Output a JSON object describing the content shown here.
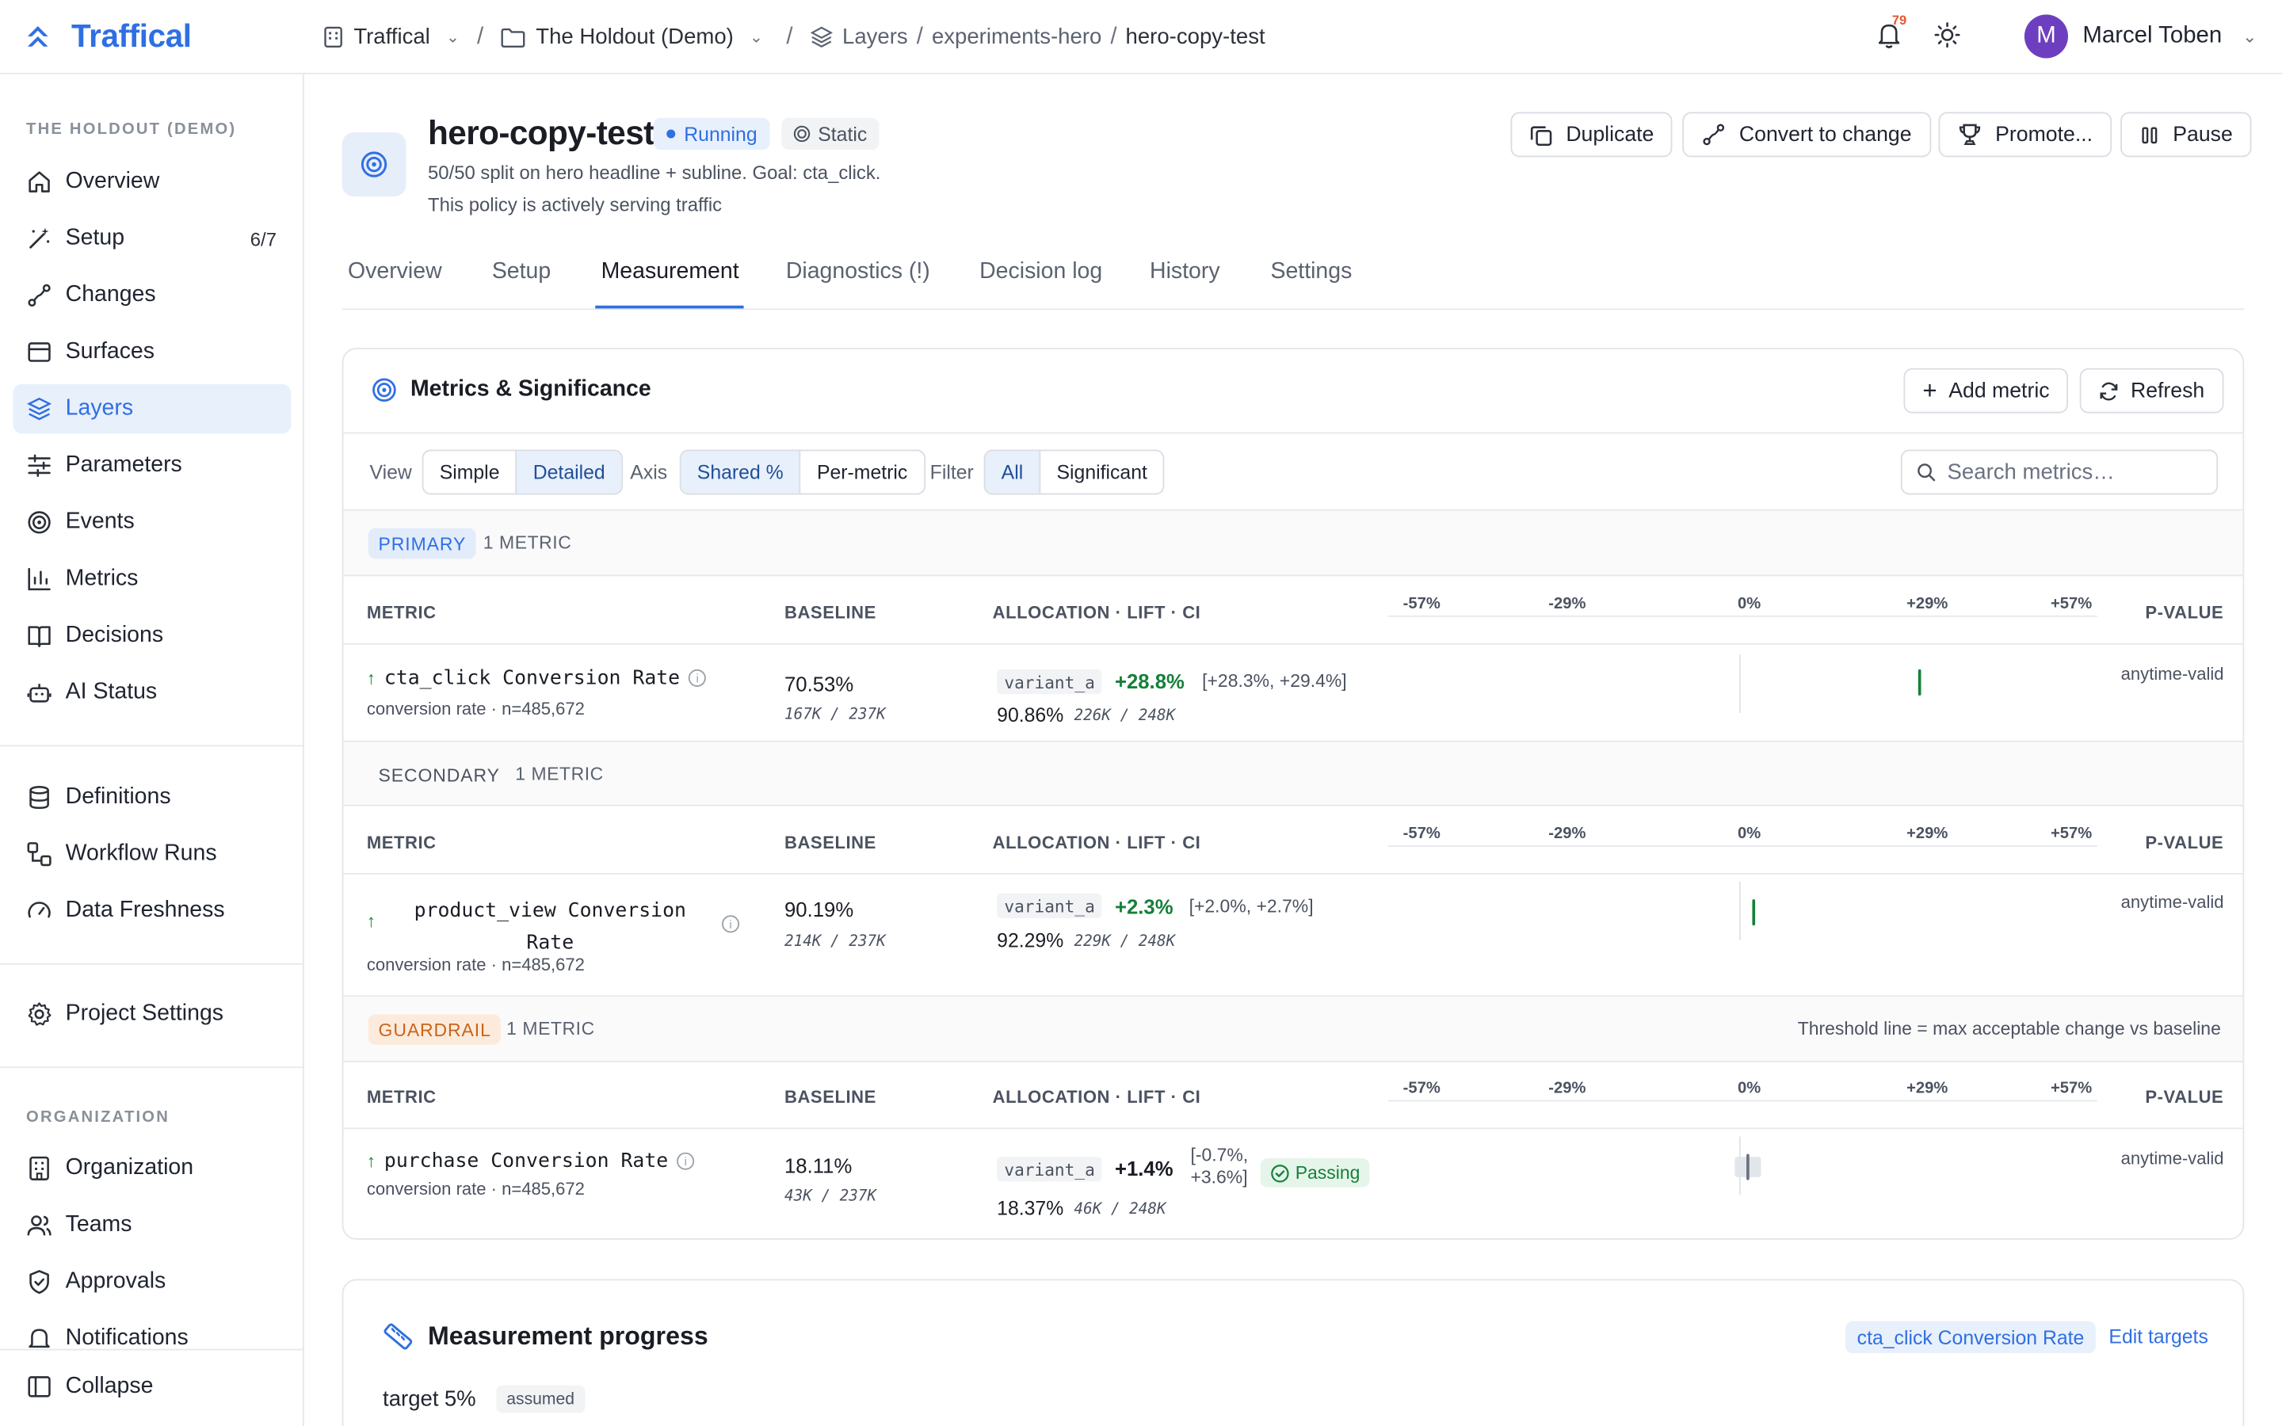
{
  "brand": {
    "name": "Traffical",
    "accent": "#2f6fe4"
  },
  "breadcrumbs": {
    "org": "Traffical",
    "project": "The Holdout (Demo)",
    "layers": "Layers",
    "layer": "experiments-hero",
    "current": "hero-copy-test"
  },
  "topbar": {
    "notification_count": "79",
    "user_name": "Marcel Toben",
    "user_initial": "M"
  },
  "sidebar": {
    "section_project": "THE HOLDOUT (DEMO)",
    "items": [
      {
        "label": "Overview",
        "icon": "home-icon"
      },
      {
        "label": "Setup",
        "icon": "wand-icon",
        "count": "6/7"
      },
      {
        "label": "Changes",
        "icon": "changes-icon"
      },
      {
        "label": "Surfaces",
        "icon": "window-icon"
      },
      {
        "label": "Layers",
        "icon": "layers-icon"
      },
      {
        "label": "Parameters",
        "icon": "sliders-icon"
      },
      {
        "label": "Events",
        "icon": "target-icon"
      },
      {
        "label": "Metrics",
        "icon": "bar-chart-icon"
      },
      {
        "label": "Decisions",
        "icon": "book-icon"
      },
      {
        "label": "AI Status",
        "icon": "bot-icon"
      }
    ],
    "items2": [
      {
        "label": "Definitions",
        "icon": "database-icon"
      },
      {
        "label": "Workflow Runs",
        "icon": "workflow-icon"
      },
      {
        "label": "Data Freshness",
        "icon": "gauge-icon"
      }
    ],
    "project_settings": "Project Settings",
    "section_org": "ORGANIZATION",
    "org_items": [
      {
        "label": "Organization",
        "icon": "building-icon"
      },
      {
        "label": "Teams",
        "icon": "users-icon"
      },
      {
        "label": "Approvals",
        "icon": "shield-check-icon"
      },
      {
        "label": "Notifications",
        "icon": "bell-icon"
      }
    ],
    "collapse": "Collapse"
  },
  "header": {
    "title": "hero-copy-test",
    "status": "Running",
    "mode": "Static",
    "description": "50/50 split on hero headline + subline. Goal: cta_click.",
    "policy_note": "This policy is actively serving traffic",
    "buttons": {
      "duplicate": "Duplicate",
      "convert": "Convert to change",
      "promote": "Promote...",
      "pause": "Pause"
    }
  },
  "tabs": [
    "Overview",
    "Setup",
    "Measurement",
    "Diagnostics (!)",
    "Decision log",
    "History",
    "Settings"
  ],
  "active_tab": "Measurement",
  "metrics_card": {
    "title": "Metrics & Significance",
    "add_metric": "Add metric",
    "refresh": "Refresh",
    "view_label": "View",
    "view_options": [
      "Simple",
      "Detailed"
    ],
    "axis_label": "Axis",
    "axis_options": [
      "Shared %",
      "Per-metric"
    ],
    "filter_label": "Filter",
    "filter_options": [
      "All",
      "Significant"
    ],
    "search_placeholder": "Search metrics…",
    "columns": {
      "metric": "METRIC",
      "baseline": "BASELINE",
      "allocation": "ALLOCATION · LIFT · CI",
      "pvalue": "P-VALUE"
    },
    "ticks": [
      "-57%",
      "-29%",
      "0%",
      "+29%",
      "+57%"
    ],
    "groups": [
      {
        "badge": "PRIMARY",
        "count": "1 METRIC",
        "note": "",
        "metric": {
          "name": "cta_click Conversion Rate",
          "sub": "conversion rate · n=485,672",
          "baseline": "70.53%",
          "baseline_n": "167K / 237K",
          "variant": "variant_a",
          "lift": "+28.8%",
          "ci": "[+28.3%, +29.4%]",
          "variant_value": "90.86%",
          "variant_n": "226K / 248K",
          "pvalue": "anytime-valid",
          "ci_low": 28.3,
          "ci_high": 29.4
        }
      },
      {
        "badge": "SECONDARY",
        "count": "1 METRIC",
        "note": "",
        "metric": {
          "name_line1": "product_view Conversion",
          "name_line2": "Rate",
          "sub": "conversion rate · n=485,672",
          "baseline": "90.19%",
          "baseline_n": "214K / 237K",
          "variant": "variant_a",
          "lift": "+2.3%",
          "ci": "[+2.0%, +2.7%]",
          "variant_value": "92.29%",
          "variant_n": "229K / 248K",
          "pvalue": "anytime-valid",
          "ci_low": 2.0,
          "ci_high": 2.7
        }
      },
      {
        "badge": "GUARDRAIL",
        "count": "1 METRIC",
        "note": "Threshold line = max acceptable change vs baseline",
        "metric": {
          "name": "purchase Conversion Rate",
          "sub": "conversion rate · n=485,672",
          "baseline": "18.11%",
          "baseline_n": "43K / 237K",
          "variant": "variant_a",
          "lift": "+1.4%",
          "ci_line1": "[-0.7%,",
          "ci_line2": "+3.6%]",
          "status": "Passing",
          "variant_value": "18.37%",
          "variant_n": "46K / 248K",
          "pvalue": "anytime-valid",
          "ci_low": -0.7,
          "ci_high": 3.6
        }
      }
    ]
  },
  "progress_card": {
    "title": "Measurement progress",
    "metric_pill": "cta_click Conversion Rate",
    "edit_targets": "Edit targets",
    "target_label": "target",
    "target_value": "5%",
    "assumed": "assumed"
  }
}
